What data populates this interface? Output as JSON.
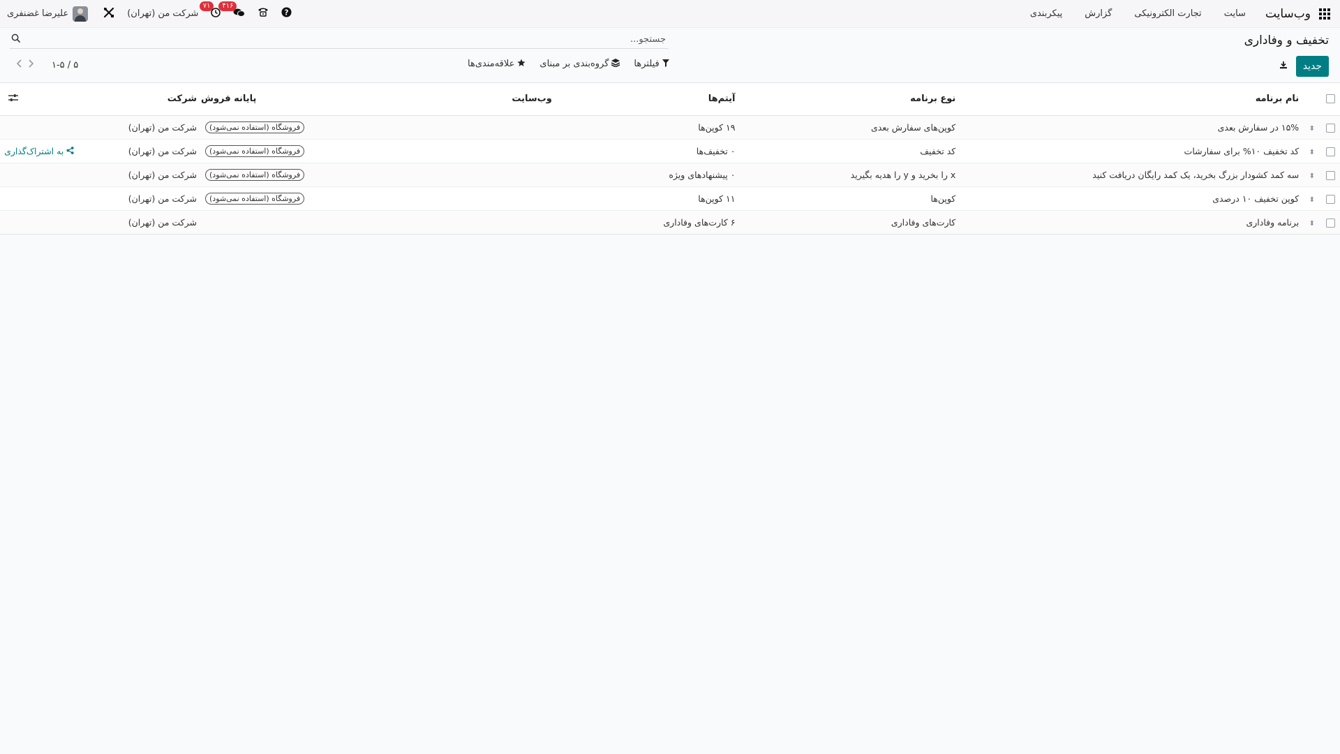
{
  "navbar": {
    "brand": "وب‌سایت",
    "menu": [
      "سایت",
      "تجارت الکترونیکی",
      "گزارش",
      "پیکربندی"
    ],
    "user_name": "علیرضا غضنفری",
    "company": "شرکت من (تهران)",
    "activity_count": "۷۱",
    "messages_count": "۴۱۶"
  },
  "page": {
    "title": "تخفیف و وفاداری",
    "new_button": "جدید",
    "search_placeholder": "جستجو...",
    "filters_label": "فیلترها",
    "group_by_label": "گروه‌بندی بر مبنای",
    "favorites_label": "علاقه‌مندی‌ها",
    "pager_value": "۱-۵ / ۵"
  },
  "table": {
    "headers": {
      "name": "نام برنامه",
      "type": "نوع برنامه",
      "items": "آیتم‌ها",
      "website": "وب‌سایت",
      "pos": "پایانه فروش",
      "company": "شرکت"
    },
    "rows": [
      {
        "name": "۱۵% در سفارش بعدی",
        "type": "کوپن‌های سفارش بعدی",
        "items": "۱۹ کوپن‌ها",
        "website": "",
        "pos": "فروشگاه (استفاده نمی‌شود)",
        "company": "شرکت من (تهران)",
        "share": ""
      },
      {
        "name": "کد تخفیف ۱۰% برای سفارشات",
        "type": "کد تخفیف",
        "items": "۰ تخفیف‌ها",
        "website": "",
        "pos": "فروشگاه (استفاده نمی‌شود)",
        "company": "شرکت من (تهران)",
        "share": "به اشتراک‌گذاری"
      },
      {
        "name": "سه کمد کشودار بزرگ بخرید، یک کمد رایگان دریافت کنید",
        "type": "x را بخرید و y را هدیه بگیرید",
        "items": "۰ پیشنهادهای ویژه",
        "website": "",
        "pos": "فروشگاه (استفاده نمی‌شود)",
        "company": "شرکت من (تهران)",
        "share": ""
      },
      {
        "name": "کوپن تخفیف ۱۰ درصدی",
        "type": "کوپن‌ها",
        "items": "۱۱ کوپن‌ها",
        "website": "",
        "pos": "فروشگاه (استفاده نمی‌شود)",
        "company": "شرکت من (تهران)",
        "share": ""
      },
      {
        "name": "برنامه وفاداری",
        "type": "کارت‌های وفاداری",
        "items": "۶ کارت‌های وفاداری",
        "website": "",
        "pos": "",
        "company": "شرکت من (تهران)",
        "share": ""
      }
    ]
  },
  "colors": {
    "accent": "#017e84",
    "badge": "#e02f3a"
  }
}
